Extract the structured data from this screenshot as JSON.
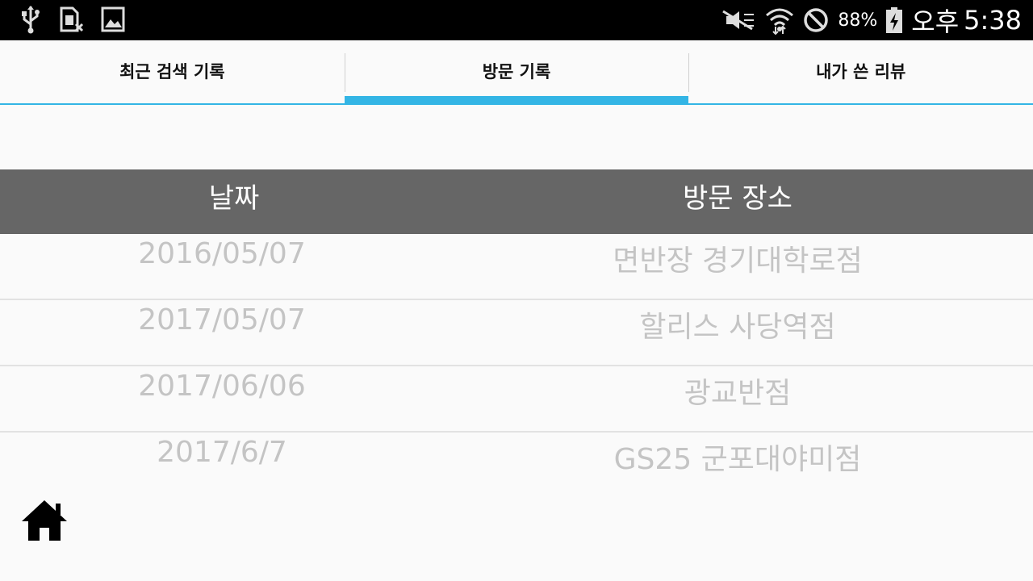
{
  "status_bar": {
    "battery": "88%",
    "ampm": "오후",
    "time": "5:38",
    "icons_left": [
      "usb-icon",
      "sim-card-icon",
      "image-icon"
    ],
    "icons_right": [
      "mute-icon",
      "wifi-icon",
      "block-icon",
      "battery-charging-icon"
    ]
  },
  "tabs": [
    {
      "label": "최근 검색 기록",
      "active": false
    },
    {
      "label": "방문 기록",
      "active": true
    },
    {
      "label": "내가 쓴 리뷰",
      "active": false
    }
  ],
  "table": {
    "headers": {
      "date": "날짜",
      "place": "방문 장소"
    },
    "rows": [
      {
        "date": "2016/05/07",
        "place": "면반장 경기대학로점"
      },
      {
        "date": "2017/05/07",
        "place": "할리스 사당역점"
      },
      {
        "date": "2017/06/06",
        "place": "광교반점"
      },
      {
        "date": "2017/6/7",
        "place": "GS25 군포대야미점"
      }
    ]
  },
  "colors": {
    "accent": "#33b5e5",
    "header_bg": "#666666",
    "row_text": "#c4c4c4"
  },
  "home": {
    "icon": "home-icon"
  }
}
